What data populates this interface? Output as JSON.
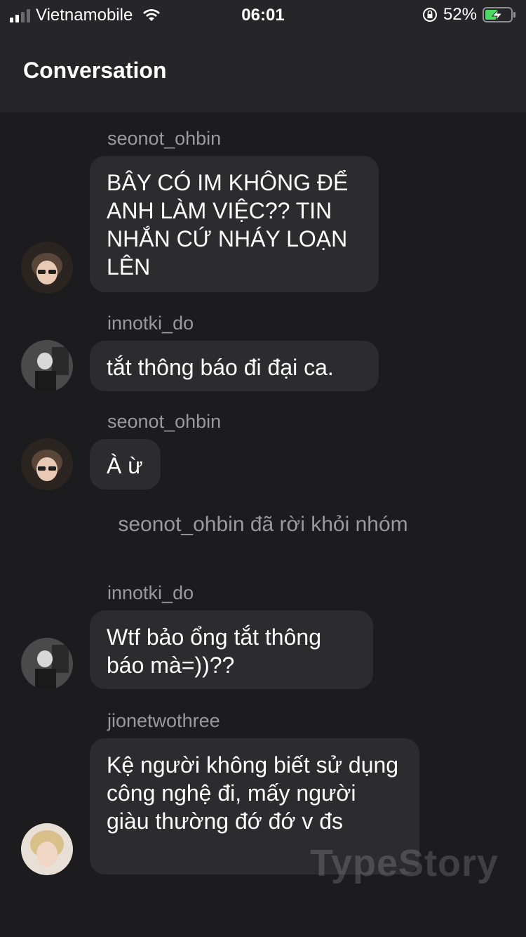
{
  "status_bar": {
    "carrier": "Vietnamobile",
    "time": "06:01",
    "battery_percent": "52%",
    "battery_level": 0.52,
    "icons": [
      "signal-icon",
      "wifi-icon",
      "orientation-lock-icon",
      "battery-charging-icon"
    ]
  },
  "header": {
    "title": "Conversation"
  },
  "messages": [
    {
      "sender": "seonot_ohbin",
      "text": "BÂY CÓ IM KHÔNG ĐỂ ANH LÀM VIỆC?? TIN NHẮN CỨ NHÁY LOẠN LÊN"
    },
    {
      "sender": "innotki_do",
      "text": "tắt thông báo đi đại ca."
    },
    {
      "sender": "seonot_ohbin",
      "text": "À ừ"
    },
    {
      "sender": "innotki_do",
      "text": "Wtf bảo ổng tắt thông báo mà=))??"
    },
    {
      "sender": "jionetwothree",
      "text": "Kệ người không biết sử dụng công nghệ đi, mấy người giàu thường đớ đớ v đs"
    }
  ],
  "system_message": "seonot_ohbin đã rời khỏi nhóm",
  "watermark": "TypeStory",
  "colors": {
    "background": "#1c1c1e",
    "header": "#262628",
    "bubble": "#2c2c2e",
    "secondary_text": "#9a9a9e"
  }
}
